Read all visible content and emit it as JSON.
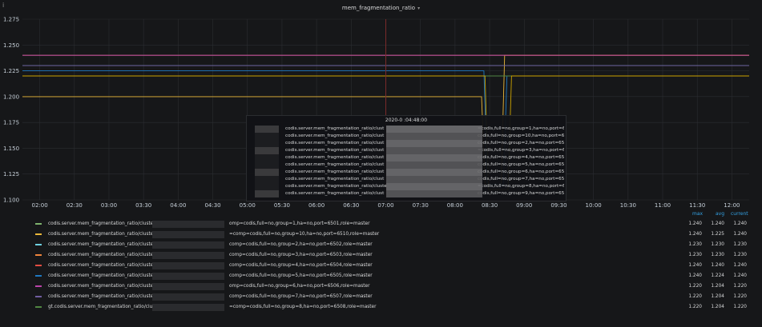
{
  "panel": {
    "title": "mem_fragmentation_ratio",
    "info_icon": "info-icon",
    "caret_icon": "chevron-down-icon"
  },
  "colors": {
    "background": "#161719",
    "grid": "#2b2d31",
    "text": "#d8d9da",
    "legend_header": "#33a2e5",
    "crosshair": "#7a2a2a"
  },
  "chart_data": {
    "type": "line",
    "title": "mem_fragmentation_ratio",
    "ylim": [
      1.1,
      1.275
    ],
    "yticks": [
      "1.100",
      "1.125",
      "1.150",
      "1.175",
      "1.200",
      "1.225",
      "1.250",
      "1.275"
    ],
    "xticks": [
      "02:00",
      "02:30",
      "03:00",
      "03:30",
      "04:00",
      "04:30",
      "05:00",
      "05:30",
      "06:00",
      "06:30",
      "07:00",
      "07:30",
      "08:00",
      "08:30",
      "09:00",
      "09:30",
      "10:00",
      "10:30",
      "11:00",
      "11:30",
      "12:00"
    ],
    "grid": true,
    "legend_placement": "bottom",
    "series": [
      {
        "color": "#7eb26d",
        "points": [
          [
            "01:45",
            1.24
          ],
          [
            "12:15",
            1.24
          ]
        ]
      },
      {
        "color": "#eab839",
        "points": [
          [
            "01:45",
            1.2
          ],
          [
            "08:23",
            1.2
          ],
          [
            "08:26",
            1.115
          ],
          [
            "08:40",
            1.115
          ],
          [
            "08:43",
            1.24
          ],
          [
            "12:15",
            1.24
          ]
        ]
      },
      {
        "color": "#6ed0e0",
        "points": [
          [
            "01:45",
            1.23
          ],
          [
            "12:15",
            1.23
          ]
        ]
      },
      {
        "color": "#ef843c",
        "points": [
          [
            "01:45",
            1.22
          ],
          [
            "12:15",
            1.22
          ]
        ]
      },
      {
        "color": "#e24d42",
        "points": [
          [
            "01:45",
            1.24
          ],
          [
            "12:15",
            1.24
          ]
        ]
      },
      {
        "color": "#1f78c1",
        "points": [
          [
            "01:45",
            1.225
          ],
          [
            "08:25",
            1.225
          ],
          [
            "08:28",
            1.115
          ],
          [
            "08:42",
            1.115
          ],
          [
            "08:45",
            1.22
          ],
          [
            "12:15",
            1.22
          ]
        ]
      },
      {
        "color": "#ba43a9",
        "points": [
          [
            "01:45",
            1.24
          ],
          [
            "12:15",
            1.24
          ]
        ]
      },
      {
        "color": "#705da0",
        "points": [
          [
            "01:45",
            1.23
          ],
          [
            "12:15",
            1.23
          ]
        ]
      },
      {
        "color": "#508642",
        "points": [
          [
            "01:45",
            1.22
          ],
          [
            "12:15",
            1.22
          ]
        ]
      },
      {
        "color": "#cca300",
        "points": [
          [
            "01:45",
            1.22
          ],
          [
            "08:26",
            1.22
          ],
          [
            "08:29",
            1.11
          ],
          [
            "08:46",
            1.11
          ],
          [
            "08:49",
            1.22
          ],
          [
            "12:15",
            1.22
          ]
        ]
      }
    ],
    "crosshair_time": "07:00"
  },
  "tooltip": {
    "time": "2020-0   :04:48:00",
    "rows": [
      {
        "left": "codis.server.mem_fragmentation_ratio/clust",
        "right": "=codis,full=no,group=1,ha=no,port=6501,r",
        "color": "#7eb26d"
      },
      {
        "left": "codis.server.mem_fragmentation_ratio/clust",
        "right": "codis,full=no,group=10,ha=no,port=6510,",
        "color": "#eab839"
      },
      {
        "left": "codis.server.mem_fragmentation_ratio/clust",
        "right": "codis,full=no,group=2,ha=no,port=6502,r",
        "color": "#6ed0e0"
      },
      {
        "left": "codis.server.mem_fragmentation_ratio/clust",
        "right": "=codis,full=no,group=3,ha=no,port=6503,r",
        "color": "#ef843c"
      },
      {
        "left": "codis.server.mem_fragmentation_ratio/clust",
        "right": "codis,full=no,group=4,ha=no,port=6504,r",
        "color": "#e24d42"
      },
      {
        "left": "codis.server.mem_fragmentation_ratio/clust",
        "right": "codis,full=no,group=5,ha=no,port=6505,r",
        "color": "#1f78c1"
      },
      {
        "left": "codis.server.mem_fragmentation_ratio/clust",
        "right": "codis,full=no,group=6,ha=no,port=6506,r",
        "color": "#ba43a9"
      },
      {
        "left": "codis.server.mem_fragmentation_ratio/clust",
        "right": "codis,full=no,group=7,ha=no,port=6507,r",
        "color": "#705da0"
      },
      {
        "left": "codis.server.mem_fragmentation_ratio/cluste",
        "right": "=codis,full=no,group=8,ha=no,port=6508,r",
        "color": "#508642"
      },
      {
        "left": "codis.server.mem_fragmentation_ratio/clust",
        "right": "codis,full=no,group=9,ha=no,port=6509,r",
        "color": "#cca300"
      }
    ]
  },
  "legend": {
    "headers": {
      "max": "max",
      "avg": "avg",
      "current": "current"
    },
    "rows": [
      {
        "name_a": "codis.server.mem_fragmentation_ratio/cluster",
        "name_b": "omp=codis,full=no,group=1,ha=no,port=6501,role=master",
        "max": "1.240",
        "avg": "1.240",
        "current": "1.240",
        "color": "#7eb26d"
      },
      {
        "name_a": "codis.server.mem_fragmentation_ratio/cluster",
        "name_b": "=comp=codis,full=no,group=10,ha=no,port=6510,role=master",
        "max": "1.240",
        "avg": "1.225",
        "current": "1.240",
        "color": "#eab839"
      },
      {
        "name_a": "codis.server.mem_fragmentation_ratio/cluster",
        "name_b": "comp=codis,full=no,group=2,ha=no,port=6502,role=master",
        "max": "1.230",
        "avg": "1.230",
        "current": "1.230",
        "color": "#6ed0e0"
      },
      {
        "name_a": "codis.server.mem_fragmentation_ratio/cluster",
        "name_b": "comp=codis,full=no,group=3,ha=no,port=6503,role=master",
        "max": "1.230",
        "avg": "1.230",
        "current": "1.230",
        "color": "#ef843c"
      },
      {
        "name_a": "codis.server.mem_fragmentation_ratio/cluster",
        "name_b": "comp=codis,full=no,group=4,ha=no,port=6504,role=master",
        "max": "1.240",
        "avg": "1.240",
        "current": "1.240",
        "color": "#e24d42"
      },
      {
        "name_a": "codis.server.mem_fragmentation_ratio/cluster",
        "name_b": "comp=codis,full=no,group=5,ha=no,port=6505,role=master",
        "max": "1.240",
        "avg": "1.224",
        "current": "1.240",
        "color": "#1f78c1"
      },
      {
        "name_a": "codis.server.mem_fragmentation_ratio/cluster",
        "name_b": "omp=codis,full=no,group=6,ha=no,port=6506,role=master",
        "max": "1.220",
        "avg": "1.204",
        "current": "1.220",
        "color": "#ba43a9"
      },
      {
        "name_a": "codis.server.mem_fragmentation_ratio/cluster",
        "name_b": "comp=codis,full=no,group=7,ha=no,port=6507,role=master",
        "max": "1.220",
        "avg": "1.204",
        "current": "1.220",
        "color": "#705da0"
      },
      {
        "name_a": "gt.codis.server.mem_fragmentation_ratio/clust",
        "name_b": "=comp=codis,full=no,group=8,ha=no,port=6508,role=master",
        "max": "1.220",
        "avg": "1.204",
        "current": "1.220",
        "color": "#508642"
      }
    ]
  }
}
